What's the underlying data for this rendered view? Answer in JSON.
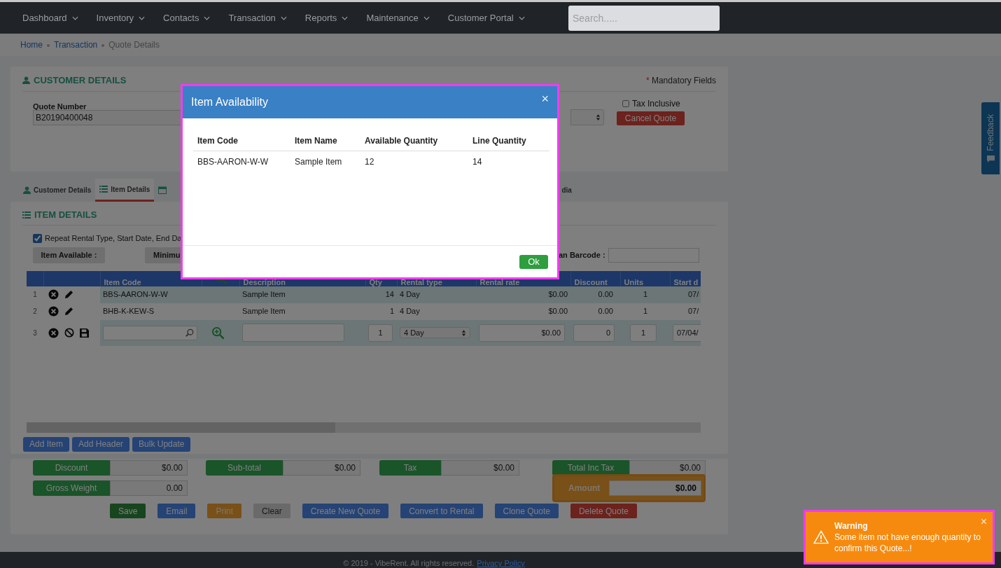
{
  "nav": {
    "items": [
      {
        "label": "Dashboard"
      },
      {
        "label": "Inventory"
      },
      {
        "label": "Contacts"
      },
      {
        "label": "Transaction"
      },
      {
        "label": "Reports"
      },
      {
        "label": "Maintenance"
      },
      {
        "label": "Customer Portal"
      }
    ],
    "search_placeholder": "Search....."
  },
  "breadcrumb": [
    {
      "label": "Home",
      "link": true
    },
    {
      "label": "Transaction",
      "link": true
    },
    {
      "label": "Quote Details",
      "link": false
    }
  ],
  "customer_details": {
    "title": "CUSTOMER DETAILS",
    "mandatory_mark": "*",
    "mandatory_note": "Mandatory Fields",
    "quote_number_label": "Quote Number",
    "quote_number": "B20190400048",
    "tax_inclusive": {
      "label": "Tax Inclusive",
      "checked": false
    },
    "cancel_button": "Cancel Quote"
  },
  "tabs": [
    {
      "label": "Customer Details",
      "kind": "user",
      "selected": false
    },
    {
      "label": "Item Details",
      "kind": "list",
      "selected": true
    },
    {
      "kind": "calendar",
      "selected": false
    },
    {
      "label": "dia",
      "kind": "plain",
      "selected": false
    }
  ],
  "item_details": {
    "title": "ITEM DETAILS",
    "repeat": {
      "label": "Repeat Rental Type, Start Date, End Da",
      "checked": true
    },
    "item_available_label": "Item Available :",
    "minimum_label": "Minimu",
    "barcode_label": "an Barcode :",
    "columns": [
      {
        "kind": "text",
        "label": "Item Code"
      },
      {
        "kind": "search"
      },
      {
        "kind": "text",
        "label": "Description"
      },
      {
        "kind": "text",
        "label": "Qty"
      },
      {
        "kind": "text",
        "label": "Rental type"
      },
      {
        "kind": "text",
        "label": "Rental rate"
      },
      {
        "kind": "text",
        "label": "Discount"
      },
      {
        "kind": "text",
        "label": "Units"
      },
      {
        "kind": "text",
        "label": "Start d"
      }
    ],
    "rows": [
      {
        "kind": "saved",
        "number": "1",
        "item_code": "BBS-AARON-W-W",
        "description": "Sample Item",
        "qty": "14",
        "rental_type": "4 Day",
        "rental_rate": "$0.00",
        "discount": "0.00",
        "units": "1",
        "start_date": "07/"
      },
      {
        "kind": "saved",
        "number": "2",
        "item_code": "BHB-K-KEW-S",
        "description": "Sample Item",
        "qty": "1",
        "rental_type": "4 Day",
        "rental_rate": "$0.00",
        "discount": "0.00",
        "units": "1",
        "start_date": "07/"
      },
      {
        "kind": "new",
        "number": "3",
        "qty": "1",
        "rental_type": "4 Day",
        "rental_rate": "$0.00",
        "discount": "0",
        "units": "1",
        "start_date": "07/04/"
      }
    ],
    "buttons": [
      "Add Item",
      "Add Header",
      "Bulk Update"
    ]
  },
  "totals": [
    {
      "label": "Discount",
      "value": "$0.00"
    },
    {
      "label": "Sub-total",
      "value": "$0.00"
    },
    {
      "label": "Tax",
      "value": "$0.00"
    },
    {
      "label": "Total Inc Tax",
      "value": "$0.00"
    },
    {
      "label": "Gross Weight",
      "value": "0.00"
    }
  ],
  "amount": {
    "label": "Amount",
    "value": "$0.00"
  },
  "actions": [
    {
      "label": "Save",
      "kind": "success"
    },
    {
      "label": "Email",
      "kind": "primary"
    },
    {
      "label": "Print",
      "kind": "warning"
    },
    {
      "label": "Clear",
      "kind": "default"
    },
    {
      "label": "Create New Quote",
      "kind": "primary"
    },
    {
      "label": "Convert to Rental",
      "kind": "primary"
    },
    {
      "label": "Clone Quote",
      "kind": "primary"
    },
    {
      "label": "Delete Quote",
      "kind": "danger"
    }
  ],
  "footer": {
    "text": "© 2019 - VibeRent. All rights reserved.",
    "link": "Privacy Policy"
  },
  "feedback": "Feedback",
  "modal": {
    "title": "Item Availability",
    "close": "×",
    "columns": [
      "Item Code",
      "Item Name",
      "Available Quantity",
      "Line Quantity"
    ],
    "rows": [
      [
        "BBS-AARON-W-W",
        "Sample Item",
        "12",
        "14"
      ]
    ],
    "ok_button": "Ok"
  },
  "toast": {
    "title": "Warning",
    "message": "Some item not have enough quantity to confirm this Quote...!",
    "close": "×"
  }
}
